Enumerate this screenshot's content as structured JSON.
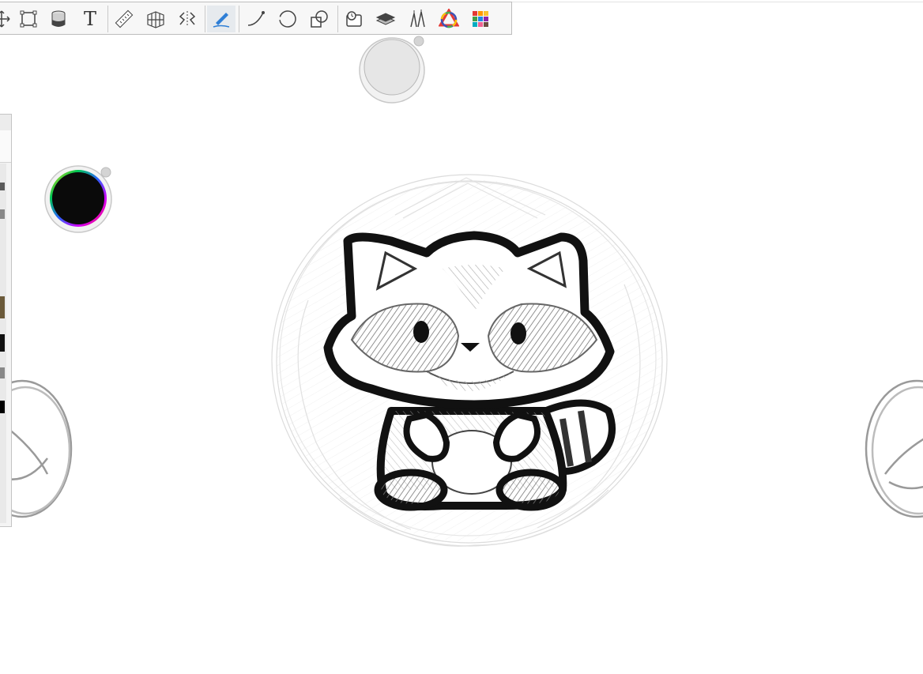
{
  "toolbar": {
    "tools": [
      {
        "id": "transform",
        "icon": "move-transform-icon"
      },
      {
        "id": "crop",
        "icon": "crop-icon"
      },
      {
        "id": "fill",
        "icon": "paint-bucket-icon"
      },
      {
        "id": "text",
        "icon": "text-icon",
        "label": "T"
      },
      {
        "id": "ruler",
        "icon": "ruler-icon"
      },
      {
        "id": "perspective",
        "icon": "perspective-grid-icon"
      },
      {
        "id": "symmetry",
        "icon": "symmetry-icon"
      },
      {
        "id": "steady-stroke",
        "icon": "predictive-stroke-icon",
        "active": true
      },
      {
        "id": "curve",
        "icon": "curve-icon"
      },
      {
        "id": "ellipse",
        "icon": "ellipse-guide-icon"
      },
      {
        "id": "shape",
        "icon": "shape-icon"
      },
      {
        "id": "reference",
        "icon": "reference-icon"
      },
      {
        "id": "layers",
        "icon": "layers-icon"
      },
      {
        "id": "brush-library",
        "icon": "brush-library-icon"
      },
      {
        "id": "color-editor",
        "icon": "color-wheel-icon"
      },
      {
        "id": "swatches",
        "icon": "swatches-icon"
      }
    ]
  },
  "brush_puck": {
    "icon": "brush-puck-icon",
    "fill": "#e6e6e6"
  },
  "color_puck": {
    "icon": "color-puck-icon",
    "fill": "#0a0a0a"
  },
  "colors": {
    "toolbar_bg": "#f7f7f7",
    "active_accent": "#2f7fd6",
    "current_color": "#0a0a0a"
  }
}
